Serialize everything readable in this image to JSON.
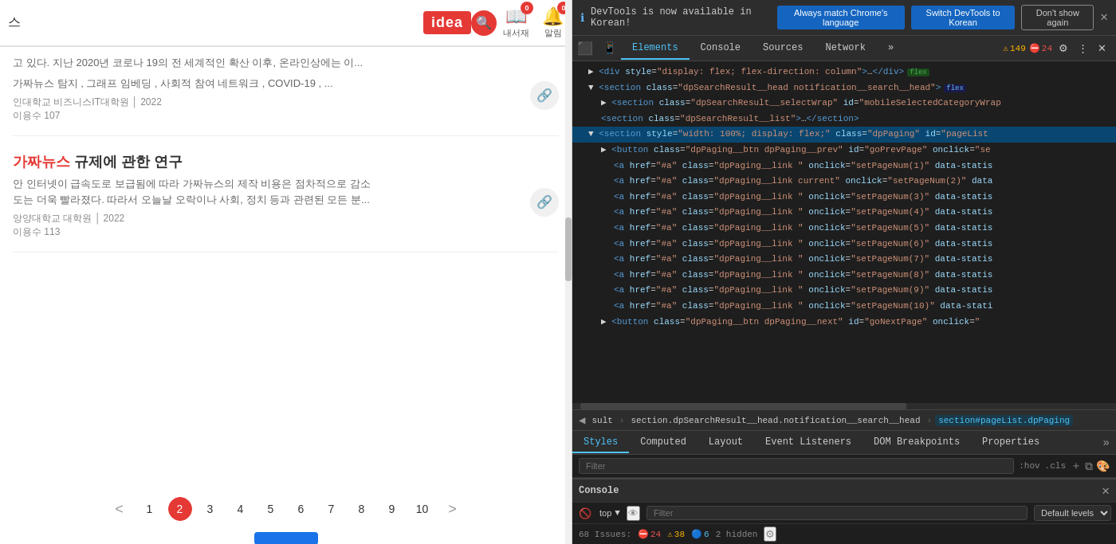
{
  "left": {
    "search_text": "스",
    "logo_text": "ide",
    "search_icon": "🔍",
    "nav_icons": [
      {
        "name": "library",
        "glyph": "📖",
        "label": "내서재",
        "badge": "0"
      },
      {
        "name": "bell",
        "glyph": "🔔",
        "label": "알림",
        "badge": "0"
      }
    ],
    "bookmark_icon": "🔗",
    "articles": [
      {
        "id": 1,
        "snippet": "고 있다. 지난 2020년 코로나 19의 전 세계적인 확산 이후, 온라인상에는 이...",
        "tags": "가짜뉴스 탐지 , 그래프 임베딩 , 사회적 참여 네트워크 , COVID-19 , ...",
        "institution": "인대학교 비즈니스IT대학원",
        "year": "2022",
        "citation": "이용수 107",
        "has_bookmark": true
      },
      {
        "id": 2,
        "title_prefix": "가",
        "title_highlight": "짜뉴스",
        "title_suffix": " 규제에 관한 연구",
        "snippet": "안 인터넷이 급속도로 보급됨에 따라 가짜뉴스의 제작 비용은 점차적으로 감소\n도는 더욱 빨라졌다. 따라서 오늘날 오락이나 사회, 정치 등과 관련된 모든 분...",
        "institution": "앙양대학교 대학원",
        "year": "2022",
        "citation": "이용수 113",
        "has_bookmark": true
      }
    ],
    "pagination": {
      "prev": "<",
      "pages": [
        "1",
        "2",
        "3",
        "4",
        "5",
        "6",
        "7",
        "8",
        "9",
        "10"
      ],
      "active": "2",
      "next": ">"
    },
    "blue_btn_label": ""
  },
  "devtools": {
    "notification": {
      "icon": "ℹ",
      "text": "DevTools is now available in Korean!",
      "btn1": "Always match Chrome's language",
      "btn2": "Switch DevTools to Korean",
      "btn3": "Don't show again"
    },
    "tabs": [
      "Elements",
      "Console",
      "Sources",
      "Network",
      "»"
    ],
    "active_tab": "Elements",
    "error_count": "149",
    "warning_count": "24",
    "dom_lines": [
      {
        "indent": 1,
        "content": "<div style=\"display: flex; flex-direction: column\">",
        "badge": "flex"
      },
      {
        "indent": 1,
        "content": "<section class=\"dpSearchResult__head notification__search__head\">",
        "badge": "flex",
        "selected": false
      },
      {
        "indent": 2,
        "content": "<section class=\"dpSearchResult__selectWrap\" id=\"mobileSelectedCategoryWrap"
      },
      {
        "indent": 2,
        "content": "<section class=\"dpSearchResult__list\">…</section>"
      },
      {
        "indent": 1,
        "content": "<section style=\"width: 100%; display: flex;\" class=\"dpPaging\" id=\"pageList",
        "selected": true
      },
      {
        "indent": 2,
        "content": "<button class=\"dpPaging__btn dpPaging__prev\" id=\"goPrevPage\" onclick=\"se"
      },
      {
        "indent": 3,
        "content": "<a href=\"#a\" class=\"dpPaging__link \" onclick=\"setPageNum(1)\" data-statis"
      },
      {
        "indent": 3,
        "content": "<a href=\"#a\" class=\"dpPaging__link current\" onclick=\"setPageNum(2)\" data"
      },
      {
        "indent": 3,
        "content": "<a href=\"#a\" class=\"dpPaging__link \" onclick=\"setPageNum(3)\" data-statis"
      },
      {
        "indent": 3,
        "content": "<a href=\"#a\" class=\"dpPaging__link \" onclick=\"setPageNum(4)\" data-statis"
      },
      {
        "indent": 3,
        "content": "<a href=\"#a\" class=\"dpPaging__link \" onclick=\"setPageNum(5)\" data-statis"
      },
      {
        "indent": 3,
        "content": "<a href=\"#a\" class=\"dpPaging__link \" onclick=\"setPageNum(6)\" data-statis"
      },
      {
        "indent": 3,
        "content": "<a href=\"#a\" class=\"dpPaging__link \" onclick=\"setPageNum(7)\" data-statis"
      },
      {
        "indent": 3,
        "content": "<a href=\"#a\" class=\"dpPaging__link \" onclick=\"setPageNum(8)\" data-statis"
      },
      {
        "indent": 3,
        "content": "<a href=\"#a\" class=\"dpPaging__link \" onclick=\"setPageNum(9)\" data-statis"
      },
      {
        "indent": 3,
        "content": "<a href=\"#a\" class=\"dpPaging__link \" onclick=\"setPageNum(10)\" data-stati"
      },
      {
        "indent": 2,
        "content": "<button class=\"dpPaging__btn dpPaging__next\" id=\"goNextPage\" onclick=\""
      }
    ],
    "breadcrumbs": [
      "sult",
      "section.dpSearchResult__head.notification__search__head",
      "section#pageList.dpPaging"
    ],
    "bottom_tabs": [
      "Styles",
      "Computed",
      "Layout",
      "Event Listeners",
      "DOM Breakpoints",
      "Properties",
      "»"
    ],
    "active_bottom_tab": "Styles",
    "filter_placeholder": "Filter",
    "filter_pseudo": ":hov",
    "filter_cls": ".cls",
    "console": {
      "title": "Console",
      "toolbar": {
        "context": "top",
        "filter_placeholder": "Filter",
        "level": "Default levels"
      },
      "status": {
        "issues": "68 Issues:",
        "errors": "24",
        "warnings": "38",
        "info": "6",
        "hidden": "2 hidden"
      }
    }
  }
}
